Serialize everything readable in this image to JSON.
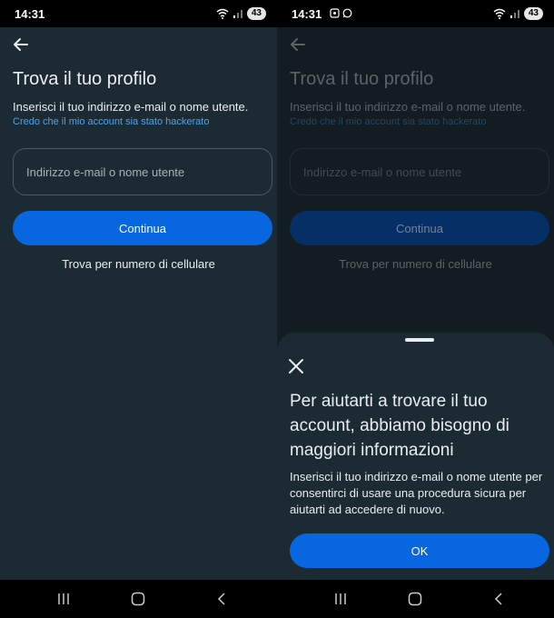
{
  "status_bar": {
    "time": "14:31",
    "battery": "43"
  },
  "screen": {
    "title": "Trova il tuo profilo",
    "subtitle": "Inserisci il tuo indirizzo e-mail o nome utente.",
    "hacked_link": "Credo che il mio account sia stato hackerato",
    "email_placeholder": "Indirizzo e-mail o nome utente",
    "continue_label": "Continua",
    "phone_link": "Trova per numero di cellulare"
  },
  "sheet": {
    "title": "Per aiutarti a trovare il tuo account, abbiamo bisogno di maggiori informazioni",
    "body": "Inserisci il tuo indirizzo e-mail o nome utente per consentirci di usare una procedura sicura per aiutarti ad accedere di nuovo.",
    "ok_label": "OK"
  },
  "colors": {
    "background": "#1c2b33",
    "primary_button": "#0866e0",
    "link": "#4aa3f0",
    "field_border": "#4b5a62"
  },
  "icons": {
    "back": "arrow-left-icon",
    "close": "close-icon",
    "nav_recents": "recents-icon",
    "nav_home": "home-icon",
    "nav_back": "nav-back-icon"
  }
}
